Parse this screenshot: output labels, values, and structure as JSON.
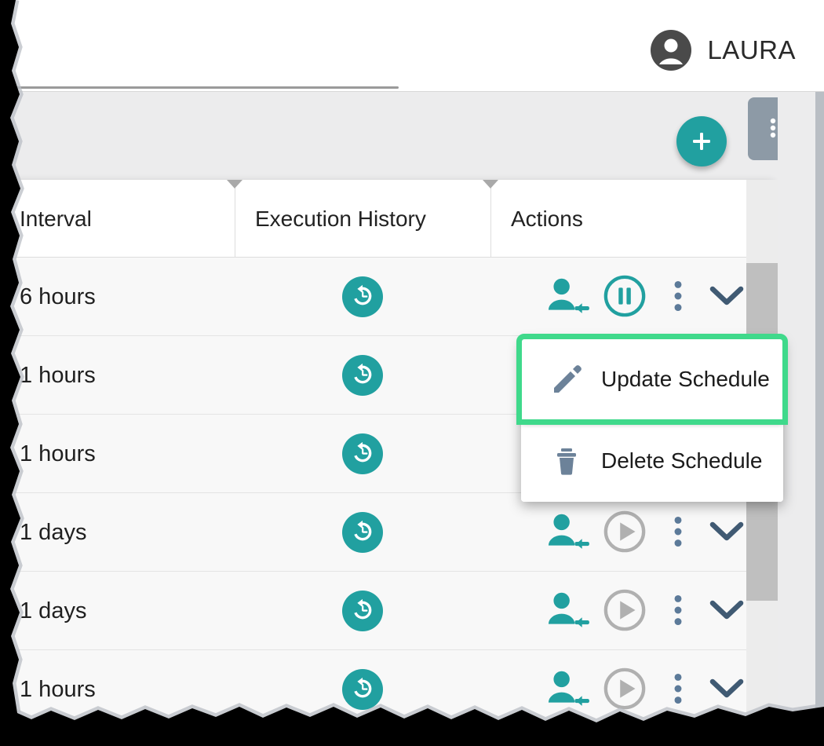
{
  "header": {
    "user_name": "LAURA",
    "avatar_icon": "account-circle-icon",
    "search_underline": true
  },
  "toolbar": {
    "add_label": "+",
    "add_icon": "plus-icon",
    "list_view_icon": "list-view-icon"
  },
  "table": {
    "columns": [
      {
        "key": "interval",
        "label": "Interval"
      },
      {
        "key": "history",
        "label": "Execution History"
      },
      {
        "key": "actions",
        "label": "Actions"
      }
    ],
    "rows": [
      {
        "interval": "6 hours",
        "history_icon": "history-icon",
        "run_state": "running",
        "run_icon": "pause-icon",
        "run_enabled": true
      },
      {
        "interval": "1 hours",
        "history_icon": "history-icon",
        "run_state": "hidden",
        "run_icon": "",
        "run_enabled": false
      },
      {
        "interval": "1 hours",
        "history_icon": "history-icon",
        "run_state": "hidden",
        "run_icon": "",
        "run_enabled": false
      },
      {
        "interval": "1 days",
        "history_icon": "history-icon",
        "run_state": "stopped",
        "run_icon": "play-icon",
        "run_enabled": false
      },
      {
        "interval": "1 days",
        "history_icon": "history-icon",
        "run_state": "stopped",
        "run_icon": "play-icon",
        "run_enabled": false
      },
      {
        "interval": "1 hours",
        "history_icon": "history-icon",
        "run_state": "stopped",
        "run_icon": "play-icon",
        "run_enabled": false
      }
    ],
    "row_action_icons": {
      "assign": "person-arrow-icon",
      "menu": "more-vertical-icon",
      "expand": "chevron-down-icon"
    }
  },
  "context_menu": {
    "items": [
      {
        "label": "Update Schedule",
        "icon": "pencil-icon",
        "highlighted": true
      },
      {
        "label": "Delete Schedule",
        "icon": "trash-icon",
        "highlighted": false
      }
    ]
  },
  "colors": {
    "teal": "#21a0a0",
    "slate": "#5c7a99",
    "highlight_green": "#3fd98b",
    "disabled_gray": "#b0b0b0",
    "toolbar_gray": "#ececed"
  }
}
